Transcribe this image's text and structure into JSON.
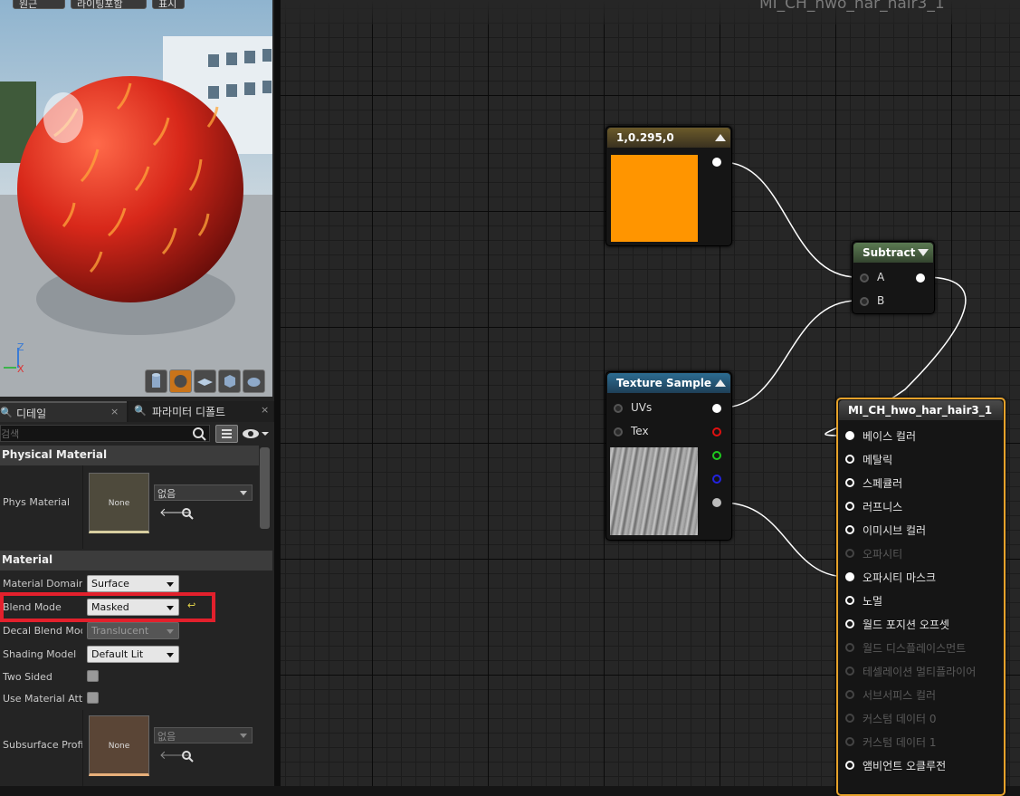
{
  "toolbar": {
    "btn1": "원근",
    "btn2": "라이팅포함",
    "btn3": "표시"
  },
  "viewport_axes": {
    "z": "Z",
    "x": "X"
  },
  "viewport_buttons": [
    "cylinder-icon",
    "sphere-icon",
    "plane-icon",
    "cube-icon",
    "teapot-icon"
  ],
  "tabs": [
    {
      "label": "디테일"
    },
    {
      "label": "파라미터 디폴트"
    }
  ],
  "search": {
    "placeholder": "검색"
  },
  "physical_material": {
    "header": "Physical Material",
    "label": "Phys Material",
    "thumb": "None",
    "value": "없음"
  },
  "material": {
    "header": "Material",
    "rows": [
      {
        "label": "Material Domain",
        "value": "Surface"
      },
      {
        "label": "Blend Mode",
        "value": "Masked"
      },
      {
        "label": "Decal Blend Mode",
        "value": "Translucent"
      },
      {
        "label": "Shading Model",
        "value": "Default Lit"
      },
      {
        "label": "Two Sided",
        "value": ""
      },
      {
        "label": "Use Material Attri",
        "value": ""
      },
      {
        "label": "Subsurface Profil",
        "value": "없음"
      }
    ],
    "subsurface_thumb": "None"
  },
  "graph": {
    "title": "MI_CH_hwo_har_hair3_1",
    "const_node": {
      "title": "1,0.295,0",
      "color": "#ff9500"
    },
    "subtract_node": {
      "title": "Subtract",
      "inputs": [
        "A",
        "B"
      ]
    },
    "texture_node": {
      "title": "Texture Sample",
      "inputs": [
        "UVs",
        "Tex"
      ]
    },
    "result_node": {
      "title": "MI_CH_hwo_har_hair3_1",
      "pins": [
        {
          "label": "베이스 컬러",
          "active": true
        },
        {
          "label": "메탈릭",
          "active": true
        },
        {
          "label": "스페큘러",
          "active": true
        },
        {
          "label": "러프니스",
          "active": true
        },
        {
          "label": "이미시브 컬러",
          "active": true
        },
        {
          "label": "오파시티",
          "active": false
        },
        {
          "label": "오파시티 마스크",
          "active": true
        },
        {
          "label": "노멀",
          "active": true
        },
        {
          "label": "월드 포지션 오프셋",
          "active": true
        },
        {
          "label": "월드 디스플레이스먼트",
          "active": false
        },
        {
          "label": "테셀레이션 멀티플라이어",
          "active": false
        },
        {
          "label": "서브서피스 컬러",
          "active": false
        },
        {
          "label": "커스텀 데이터 0",
          "active": false
        },
        {
          "label": "커스텀 데이터 1",
          "active": false
        },
        {
          "label": "앰비언트 오클루전",
          "active": true
        }
      ]
    }
  }
}
